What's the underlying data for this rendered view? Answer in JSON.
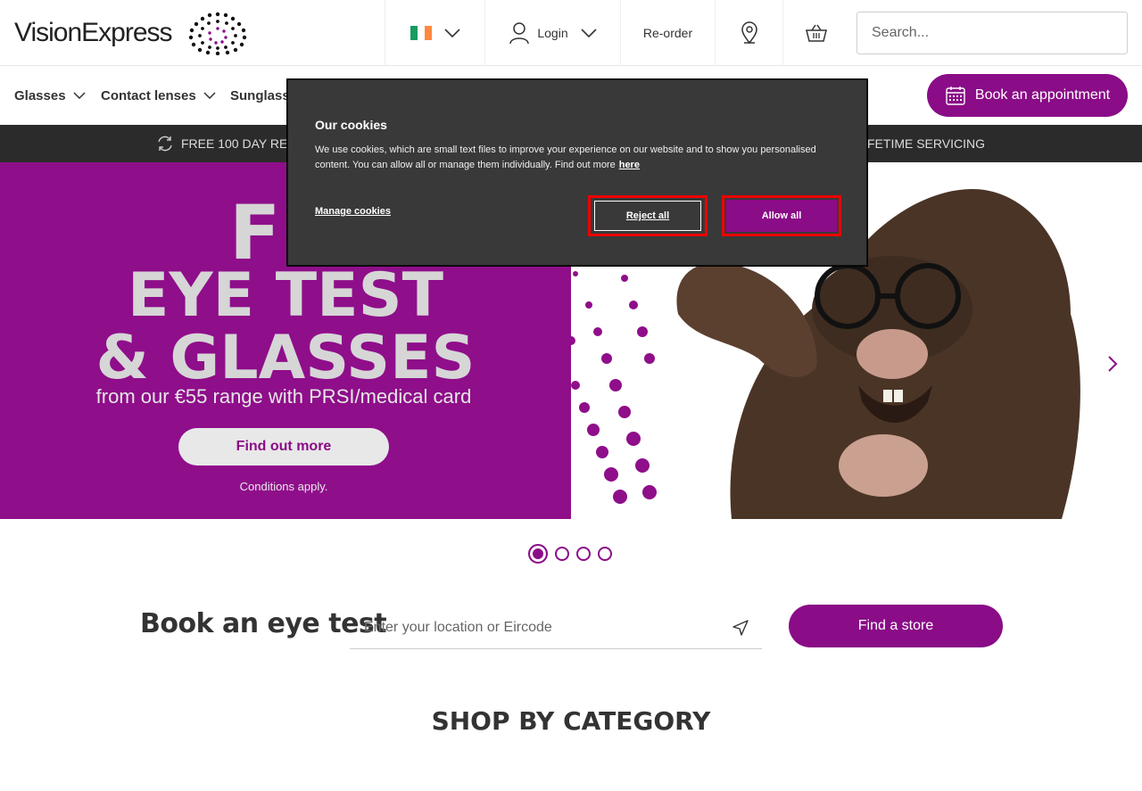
{
  "header": {
    "logo_text": "VisionExpress",
    "country_flag": "ireland-flag",
    "login_label": "Login",
    "reorder_label": "Re-order",
    "search_placeholder": "Search..."
  },
  "nav": {
    "items": [
      {
        "label": "Glasses"
      },
      {
        "label": "Contact lenses"
      },
      {
        "label": "Sunglass"
      }
    ],
    "book_label": "Book an appointment"
  },
  "usp": {
    "left": "FREE 100 DAY RE",
    "right": "FETIME SERVICING"
  },
  "hero": {
    "line1": "FR",
    "line2": "EYE TEST",
    "line3": "& GLASSES",
    "subtitle": "from our €55 range with PRSI/medical card",
    "cta": "Find out more",
    "conditions": "Conditions apply.",
    "slide_active": 1,
    "slide_count": 4
  },
  "eye_test": {
    "title": "Book an eye test",
    "input_placeholder": "Enter your location or Eircode",
    "button": "Find a store"
  },
  "shop": {
    "title": "SHOP BY CATEGORY"
  },
  "cookies": {
    "title": "Our cookies",
    "text": "We use cookies, which are small text files to improve your experience on our website and to show you personalised content. You can allow all or manage them individually. Find out more",
    "link": "here",
    "manage": "Manage cookies",
    "reject": "Reject all",
    "allow": "Allow all"
  },
  "colors": {
    "brand": "#8a0c87",
    "dark_bar": "#2b2b2b",
    "modal_bg": "#393939",
    "highlight": "#ee0000"
  }
}
